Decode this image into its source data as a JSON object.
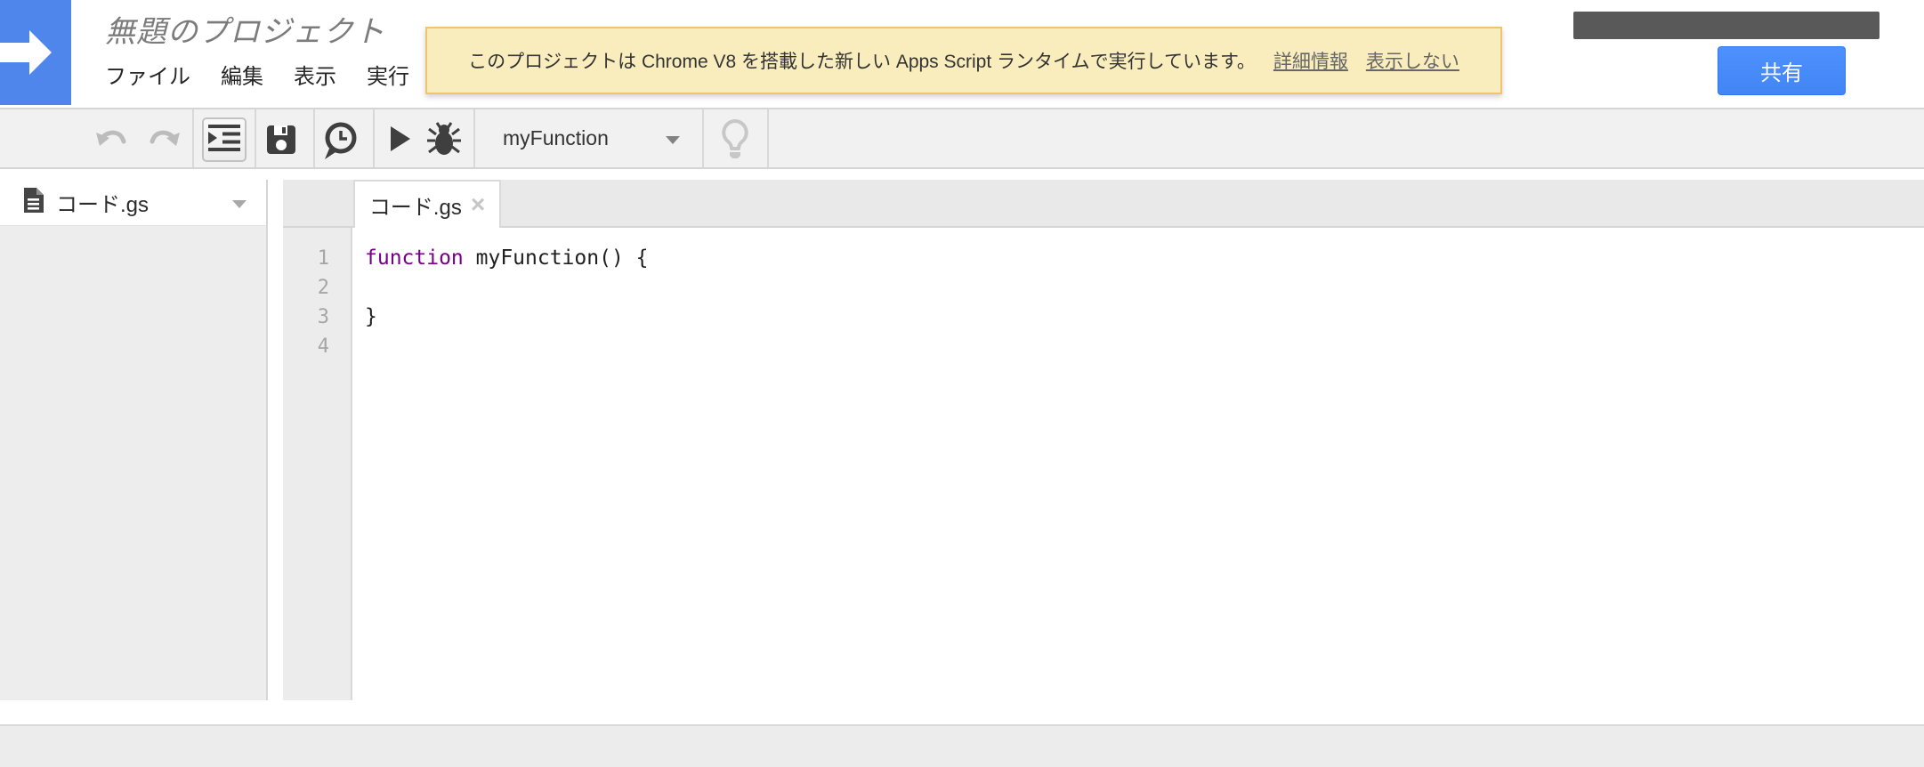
{
  "header": {
    "title": "無題のプロジェクト",
    "menus": [
      "ファイル",
      "編集",
      "表示",
      "実行"
    ],
    "share_button": "共有"
  },
  "banner": {
    "message": "このプロジェクトは Chrome V8 を搭載した新しい Apps Script ランタイムで実行しています。",
    "learn_more_link": "詳細情報",
    "dismiss_link": "表示しない"
  },
  "toolbar": {
    "function_selector_value": "myFunction",
    "icons": [
      "undo-icon",
      "redo-icon",
      "indent-icon",
      "save-icon",
      "history-clock-icon",
      "run-icon",
      "debug-icon",
      "dropdown-caret-icon",
      "lightbulb-icon"
    ]
  },
  "sidebar": {
    "files": [
      {
        "name": "コード.gs",
        "icon": "script-file-icon"
      }
    ]
  },
  "editor": {
    "tab": {
      "label": "コード.gs",
      "close_glyph": "×"
    },
    "code": {
      "lines": [
        {
          "num": "1",
          "keyword": "function",
          "rest": " myFunction() {"
        },
        {
          "num": "2",
          "plain": ""
        },
        {
          "num": "3",
          "plain": "}"
        },
        {
          "num": "4",
          "plain": ""
        }
      ]
    }
  },
  "colors": {
    "logo_blue": "#4e86ec",
    "share_blue": "#4d90fe",
    "banner_bg": "#f9edbe",
    "banner_border": "#f0c36d",
    "keyword_purple": "#770088",
    "account_bar_gray": "#595959"
  }
}
